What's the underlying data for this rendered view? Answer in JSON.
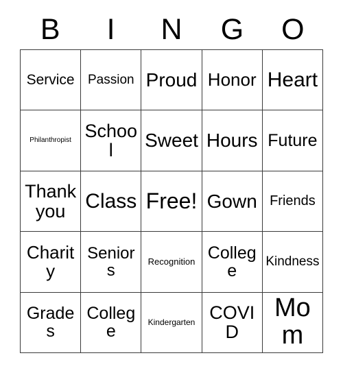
{
  "card": {
    "header_letters": [
      "B",
      "I",
      "N",
      "G",
      "O"
    ],
    "columns": 5,
    "rows": 5,
    "text_color": "#000000",
    "border_color": "#3a3a3a",
    "background_color": "#ffffff",
    "cells": [
      [
        {
          "label": "Service",
          "size": "fs-21"
        },
        {
          "label": "Passion",
          "size": "fs-19"
        },
        {
          "label": "Proud",
          "size": "fs-28"
        },
        {
          "label": "Honor",
          "size": "fs-26"
        },
        {
          "label": "Heart",
          "size": "fs-30"
        }
      ],
      [
        {
          "label": "Philanthropist",
          "size": "fs-10"
        },
        {
          "label": "School",
          "size": "fs-27"
        },
        {
          "label": "Sweet",
          "size": "fs-28"
        },
        {
          "label": "Hours",
          "size": "fs-28"
        },
        {
          "label": "Future",
          "size": "fs-25"
        }
      ],
      [
        {
          "label": "Thank you",
          "size": "fs-27"
        },
        {
          "label": "Class",
          "size": "fs-30"
        },
        {
          "label": "Free!",
          "size": "fs-32"
        },
        {
          "label": "Gown",
          "size": "fs-28"
        },
        {
          "label": "Friends",
          "size": "fs-20"
        }
      ],
      [
        {
          "label": "Charity",
          "size": "fs-26"
        },
        {
          "label": "Seniors",
          "size": "fs-24"
        },
        {
          "label": "Recognition",
          "size": "fs-13"
        },
        {
          "label": "College",
          "size": "fs-25"
        },
        {
          "label": "Kindness",
          "size": "fs-19"
        }
      ],
      [
        {
          "label": "Grades",
          "size": "fs-25"
        },
        {
          "label": "College",
          "size": "fs-25"
        },
        {
          "label": "Kindergarten",
          "size": "fs-12"
        },
        {
          "label": "COVID",
          "size": "fs-27"
        },
        {
          "label": "Mom",
          "size": "fs-38"
        }
      ]
    ]
  }
}
